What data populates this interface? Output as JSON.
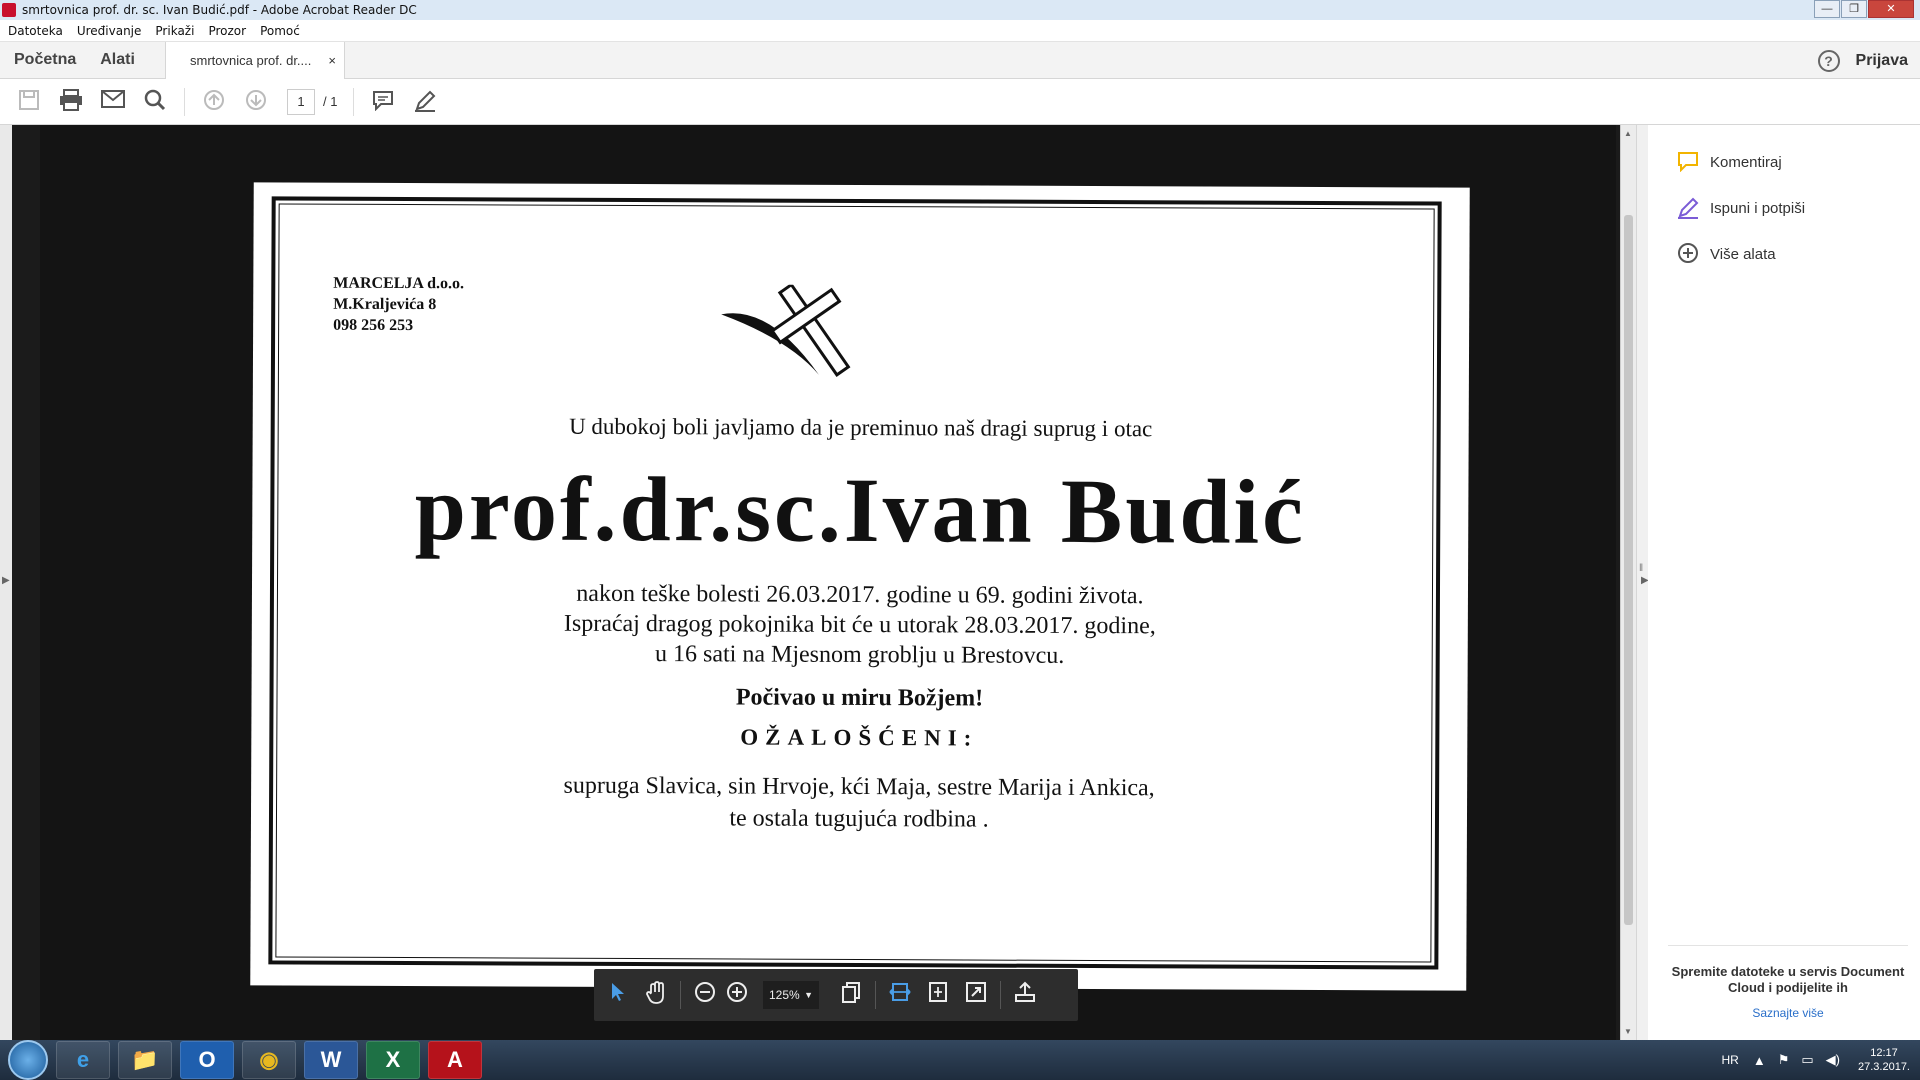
{
  "window": {
    "title": "smrtovnica prof. dr. sc. Ivan Budić.pdf - Adobe Acrobat Reader DC",
    "buttons": [
      "—",
      "❐",
      "✕"
    ]
  },
  "menu": [
    "Datoteka",
    "Uređivanje",
    "Prikaži",
    "Prozor",
    "Pomoć"
  ],
  "tabs": {
    "home": "Početna",
    "tools": "Alati",
    "document": "smrtovnica prof. dr....",
    "close": "×",
    "help": "?",
    "signin": "Prijava"
  },
  "toolbar": {
    "page_current": "1",
    "page_total": "/ 1"
  },
  "card": {
    "company_lines": [
      "MARCELJA d.o.o.",
      "M.Kraljevića 8",
      "098 256 253"
    ],
    "intro": "U dubokoj boli javljamo da je preminuo naš dragi suprug i otac",
    "name": "prof.dr.sc.Ivan Budić",
    "details": [
      "nakon teške bolesti 26.03.2017. godine u 69. godini života.",
      "Ispraćaj dragog pokojnika bit će u utorak 28.03.2017. godine,",
      "u 16 sati na Mjesnom groblju u Brestovcu."
    ],
    "rip": "Počivao u miru Božjem!",
    "mourners_label": "OŽALOŠĆENI:",
    "family": [
      "supruga Slavica, sin Hrvoje, kći Maja, sestre Marija i Ankica,",
      "te ostala tugujuća rodbina ."
    ]
  },
  "floating_toolbar": {
    "zoom": "125%"
  },
  "right_panel": {
    "tools": [
      {
        "label": "Komentiraj",
        "icon": "comment-icon",
        "color": "#f2b400"
      },
      {
        "label": "Ispuni i potpiši",
        "icon": "fill-sign-icon",
        "color": "#7b5cd6"
      },
      {
        "label": "Više alata",
        "icon": "plus-circle-icon",
        "color": "#555555"
      }
    ],
    "promo_text": "Spremite datoteke u servis Document Cloud i podijelite ih",
    "promo_link": "Saznajte više"
  },
  "taskbar": {
    "apps": [
      "e",
      "📁",
      "O",
      "◉",
      "W",
      "X",
      "A"
    ],
    "lang": "HR",
    "time": "12:17",
    "date": "27.3.2017."
  }
}
